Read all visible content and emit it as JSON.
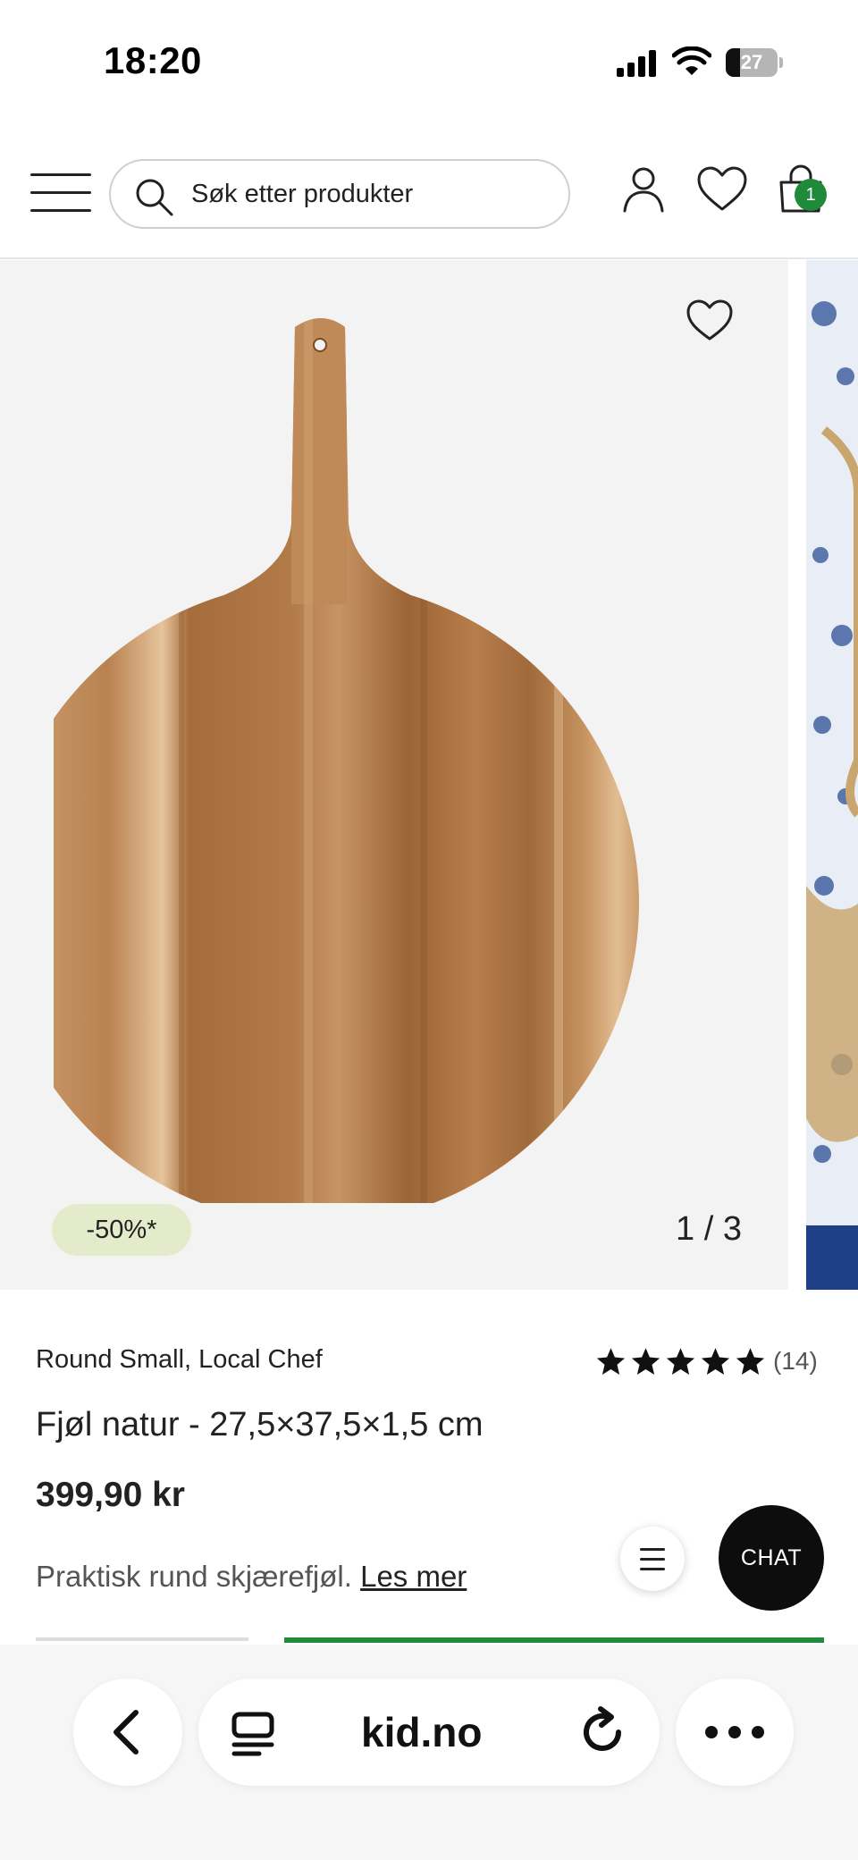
{
  "status_bar": {
    "time": "18:20",
    "battery_level": "27"
  },
  "header": {
    "search_placeholder": "Søk etter produkter",
    "cart_count": "1"
  },
  "gallery": {
    "discount_label": "-50%*",
    "counter": "1 / 3"
  },
  "product": {
    "brand": "Round Small, Local Chef",
    "rating_stars": 5,
    "review_count": "(14)",
    "title": "Fjøl natur - 27,5×37,5×1,5 cm",
    "price": "399,90 kr",
    "description": "Praktisk rund skjærefjøl.",
    "read_more": "Les mer"
  },
  "floating": {
    "chat_label": "CHAT"
  },
  "browser": {
    "url": "kid.no"
  },
  "colors": {
    "accent_green": "#1f8a3a",
    "discount_bg": "#e4ebcb",
    "chat_bg": "#0d0d0d"
  }
}
